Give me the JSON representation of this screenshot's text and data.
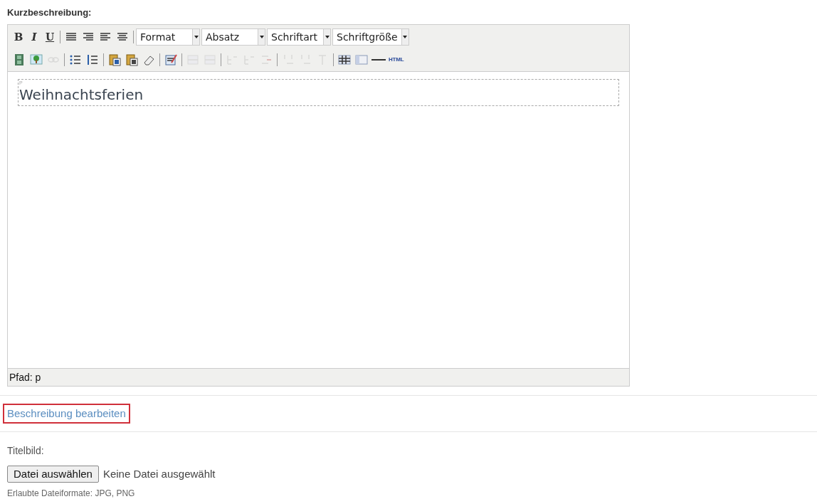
{
  "field_label": "Kurzbeschreibung:",
  "toolbar_rows": [
    [
      {
        "kind": "text",
        "label": "B",
        "disabled": false
      },
      {
        "kind": "text",
        "label": "I",
        "disabled": false
      },
      {
        "kind": "text",
        "label": "U",
        "disabled": false
      },
      {
        "kind": "separator"
      },
      {
        "kind": "icon",
        "disabled": false
      },
      {
        "kind": "icon",
        "disabled": false
      },
      {
        "kind": "icon",
        "disabled": false
      },
      {
        "kind": "icon",
        "disabled": false
      },
      {
        "kind": "separator"
      },
      {
        "kind": "select",
        "label": "Format"
      },
      {
        "kind": "select",
        "label": "Absatz"
      },
      {
        "kind": "select",
        "label": "Schriftart"
      },
      {
        "kind": "select",
        "label": "Schriftgröße"
      }
    ],
    [
      {
        "kind": "icon",
        "disabled": false
      },
      {
        "kind": "icon",
        "disabled": false
      },
      {
        "kind": "icon",
        "disabled": true
      },
      {
        "kind": "separator"
      },
      {
        "kind": "icon",
        "disabled": false
      },
      {
        "kind": "icon",
        "disabled": false
      },
      {
        "kind": "separator"
      },
      {
        "kind": "icon",
        "disabled": false
      },
      {
        "kind": "icon",
        "disabled": false
      },
      {
        "kind": "icon",
        "disabled": false
      },
      {
        "kind": "separator"
      },
      {
        "kind": "icon",
        "disabled": false
      },
      {
        "kind": "separator"
      },
      {
        "kind": "icon",
        "disabled": true
      },
      {
        "kind": "icon",
        "disabled": true
      },
      {
        "kind": "separator"
      },
      {
        "kind": "icon",
        "disabled": true
      },
      {
        "kind": "icon",
        "disabled": true
      },
      {
        "kind": "icon",
        "disabled": true
      },
      {
        "kind": "separator"
      },
      {
        "kind": "icon",
        "disabled": true
      },
      {
        "kind": "icon",
        "disabled": true
      },
      {
        "kind": "icon",
        "disabled": true
      },
      {
        "kind": "separator"
      },
      {
        "kind": "icon",
        "disabled": false
      },
      {
        "kind": "icon",
        "disabled": false
      },
      {
        "kind": "icon",
        "disabled": false
      },
      {
        "kind": "text",
        "label": "HTML",
        "disabled": false
      }
    ]
  ],
  "editor": {
    "block_marker": "P",
    "content": "Weihnachtsferien",
    "path": "Pfad: p"
  },
  "edit_link": "Beschreibung bearbeiten",
  "cover": {
    "label": "Titelbild:",
    "button": "Datei auswählen",
    "status": "Keine Datei ausgewählt",
    "hint": "Erlaubte Dateiformate: JPG, PNG"
  }
}
